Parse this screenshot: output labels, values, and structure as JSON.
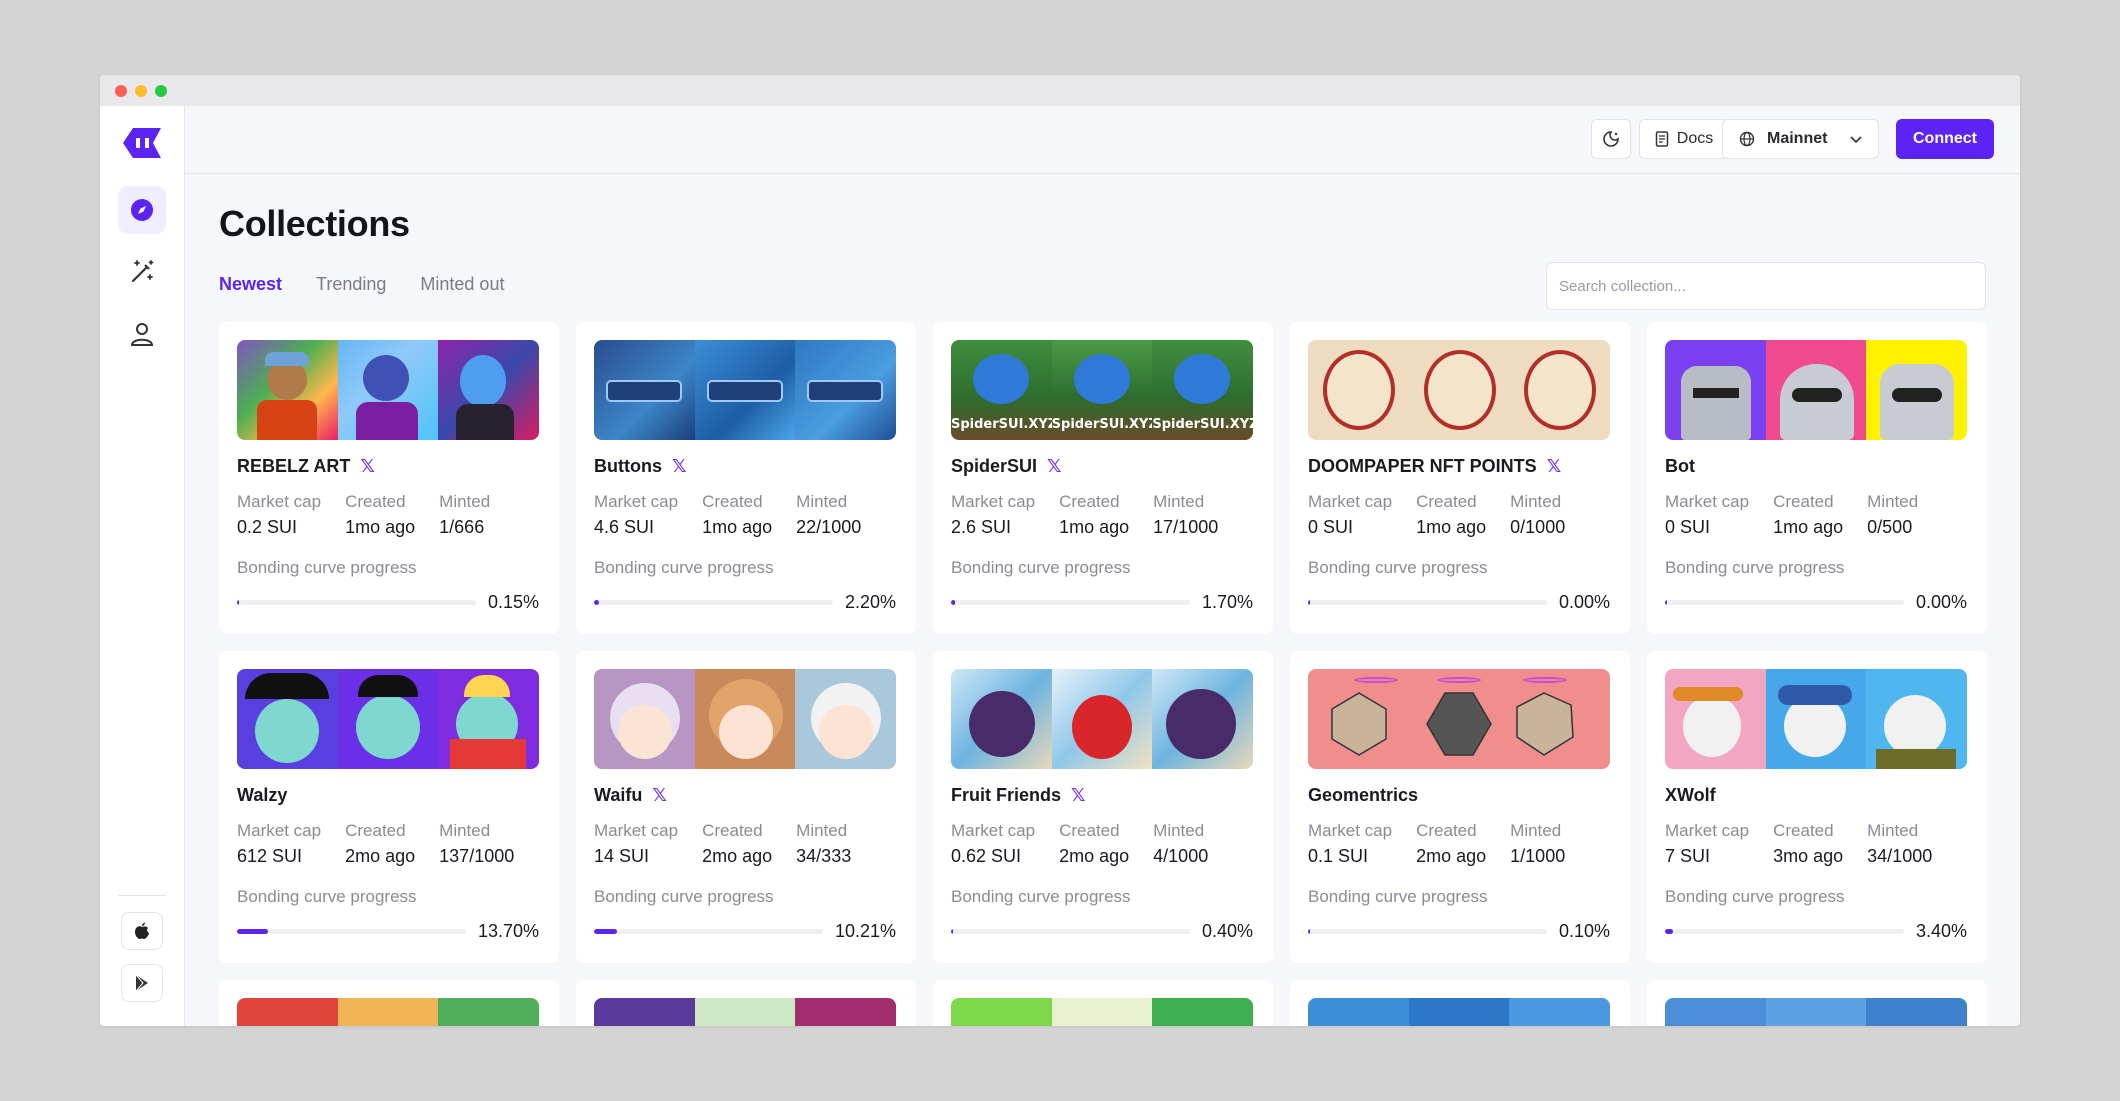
{
  "page": {
    "title": "Collections"
  },
  "topbar": {
    "docs_label": "Docs",
    "network_label": "Mainnet",
    "connect_label": "Connect"
  },
  "tabs": [
    {
      "label": "Newest"
    },
    {
      "label": "Trending"
    },
    {
      "label": "Minted out"
    }
  ],
  "search": {
    "placeholder": "Search collection..."
  },
  "labels": {
    "market_cap": "Market cap",
    "created": "Created",
    "minted": "Minted",
    "bonding": "Bonding curve progress"
  },
  "colors": {
    "accent": "#5b24f5"
  },
  "cards": [
    {
      "name": "REBELZ ART",
      "x": true,
      "market_cap": "0.2  SUI",
      "created": "1mo ago",
      "minted": "1/666",
      "progress_text": "0.15%",
      "progress": 0.0015
    },
    {
      "name": "Buttons",
      "x": true,
      "market_cap": "4.6  SUI",
      "created": "1mo ago",
      "minted": "22/1000",
      "progress_text": "2.20%",
      "progress": 0.022
    },
    {
      "name": "SpiderSUI",
      "x": true,
      "market_cap": "2.6  SUI",
      "created": "1mo ago",
      "minted": "17/1000",
      "progress_text": "1.70%",
      "progress": 0.017,
      "thumb_text": "SpiderSUI.XYZ"
    },
    {
      "name": "DOOMPAPER NFT POINTS",
      "x": true,
      "market_cap": "0  SUI",
      "created": "1mo ago",
      "minted": "0/1000",
      "progress_text": "0.00%",
      "progress": 0.0
    },
    {
      "name": "Bot",
      "x": false,
      "market_cap": "0  SUI",
      "created": "1mo ago",
      "minted": "0/500",
      "progress_text": "0.00%",
      "progress": 0.0
    },
    {
      "name": "Walzy",
      "x": false,
      "market_cap": "612  SUI",
      "created": "2mo ago",
      "minted": "137/1000",
      "progress_text": "13.70%",
      "progress": 0.137
    },
    {
      "name": "Waifu",
      "x": true,
      "market_cap": "14  SUI",
      "created": "2mo ago",
      "minted": "34/333",
      "progress_text": "10.21%",
      "progress": 0.1021
    },
    {
      "name": "Fruit Friends",
      "x": true,
      "market_cap": "0.62  SUI",
      "created": "2mo ago",
      "minted": "4/1000",
      "progress_text": "0.40%",
      "progress": 0.004
    },
    {
      "name": "Geomentrics",
      "x": false,
      "market_cap": "0.1  SUI",
      "created": "2mo ago",
      "minted": "1/1000",
      "progress_text": "0.10%",
      "progress": 0.001
    },
    {
      "name": "XWolf",
      "x": false,
      "market_cap": "7  SUI",
      "created": "3mo ago",
      "minted": "34/1000",
      "progress_text": "3.40%",
      "progress": 0.034
    }
  ]
}
